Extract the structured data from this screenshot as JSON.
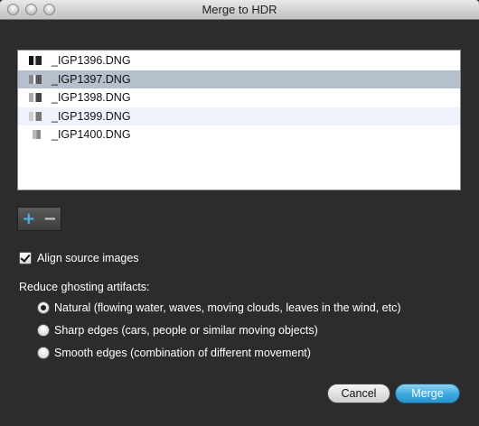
{
  "window": {
    "title": "Merge to HDR",
    "controls": [
      "close",
      "minimize",
      "zoom"
    ]
  },
  "files": [
    {
      "name": "_IGP1396.DNG",
      "selected": false
    },
    {
      "name": "_IGP1397.DNG",
      "selected": true
    },
    {
      "name": "_IGP1398.DNG",
      "selected": false
    },
    {
      "name": "_IGP1399.DNG",
      "selected": false
    },
    {
      "name": "_IGP1400.DNG",
      "selected": false
    }
  ],
  "list_controls": {
    "add_label": "+",
    "remove_label": "−"
  },
  "align": {
    "label": "Align source images",
    "checked": true
  },
  "ghosting": {
    "label": "Reduce ghosting artifacts:",
    "options": [
      {
        "label": "Natural (flowing water, waves, moving clouds, leaves in the wind, etc)",
        "selected": true
      },
      {
        "label": "Sharp edges (cars, people or similar moving objects)",
        "selected": false
      },
      {
        "label": "Smooth edges (combination of different movement)",
        "selected": false
      }
    ]
  },
  "buttons": {
    "cancel": "Cancel",
    "merge": "Merge"
  },
  "colors": {
    "background": "#2c2c2c",
    "selection": "#b6bfcc",
    "accent": "#3aa8dd"
  }
}
